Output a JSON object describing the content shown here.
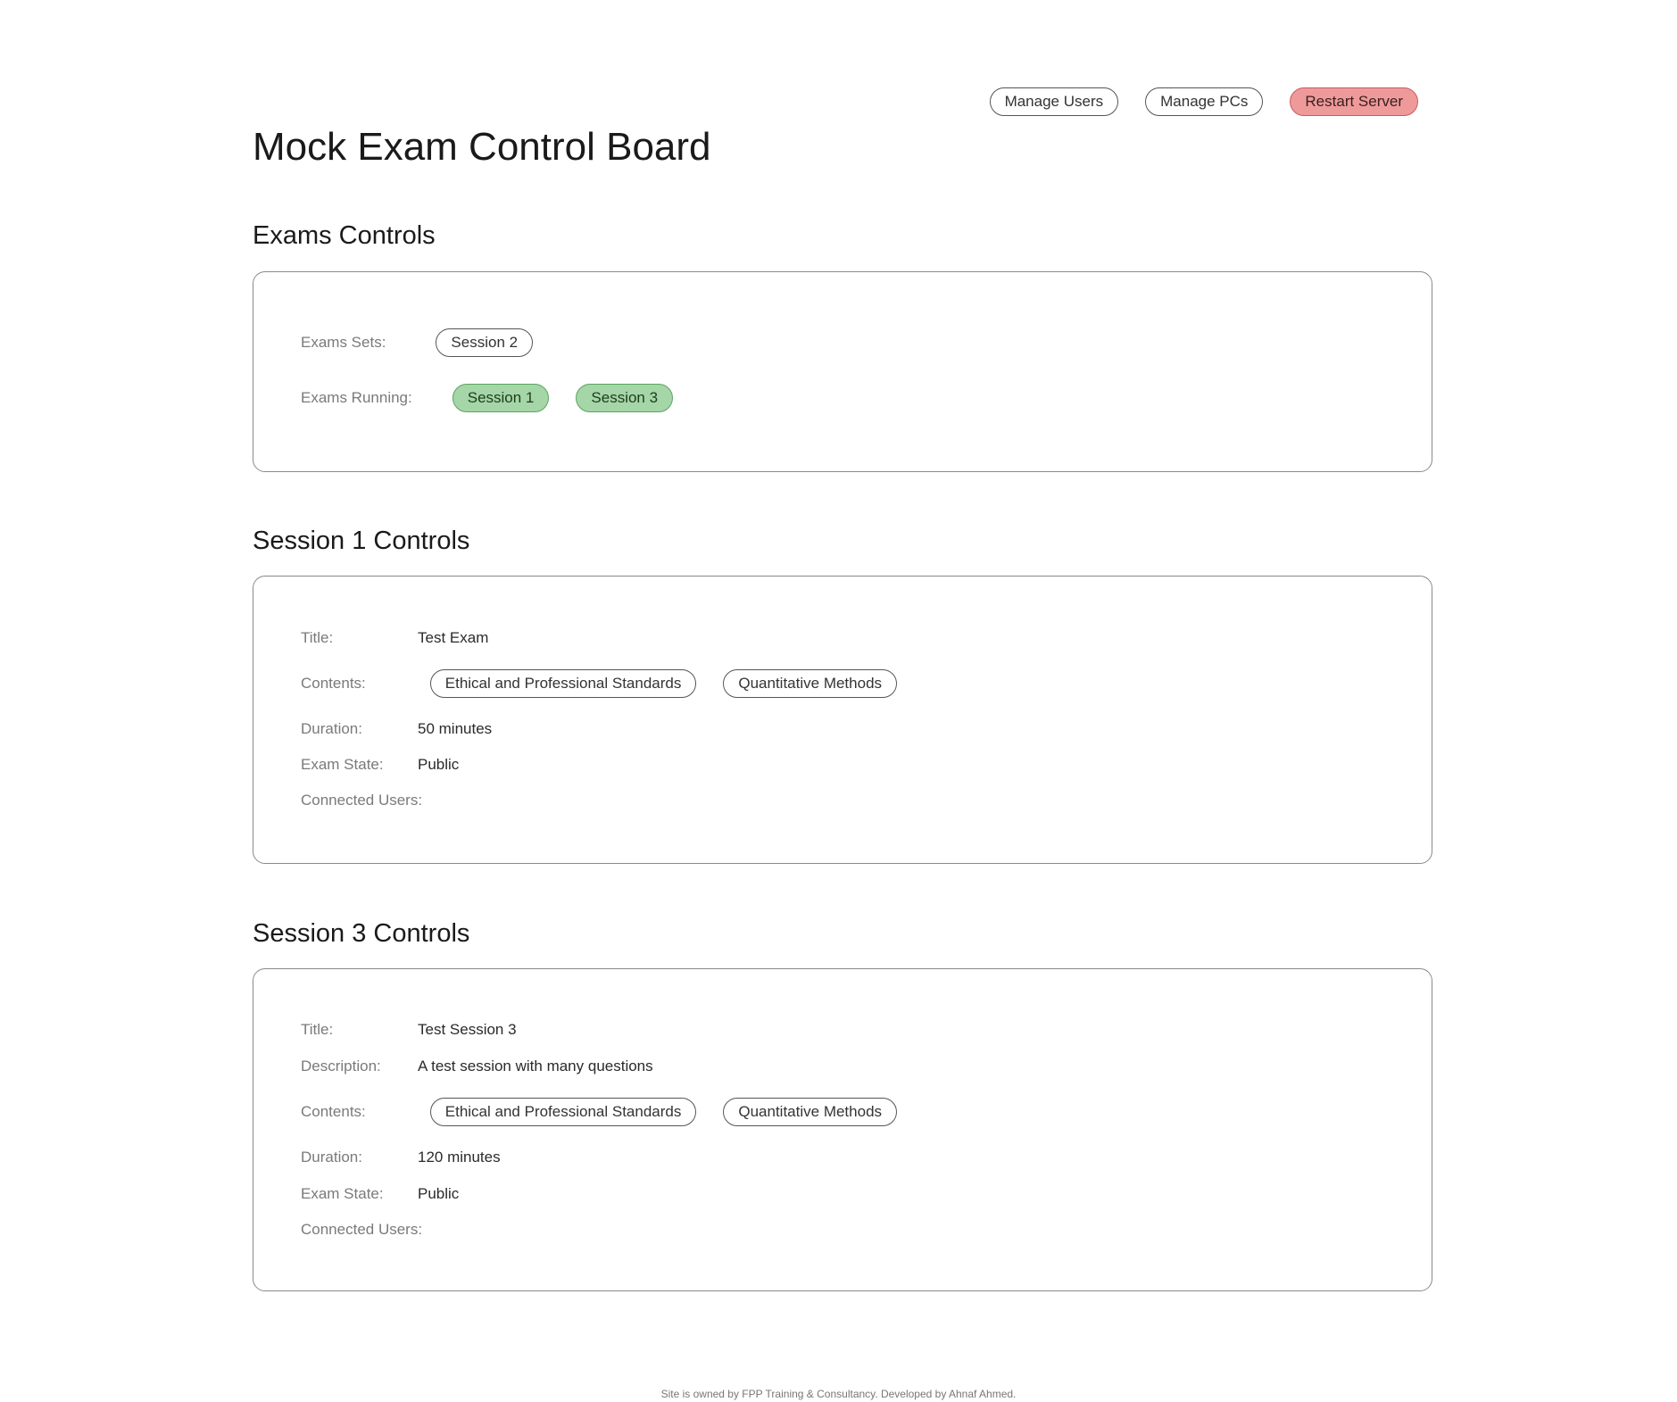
{
  "header": {
    "title": "Mock Exam Control Board",
    "actions": {
      "manage_users": "Manage Users",
      "manage_pcs": "Manage PCs",
      "restart_server": "Restart Server"
    }
  },
  "exams_controls": {
    "heading": "Exams Controls",
    "sets_label": "Exams Sets:",
    "sets": [
      "Session 2"
    ],
    "running_label": "Exams Running:",
    "running": [
      "Session 1",
      "Session 3"
    ]
  },
  "session1": {
    "heading": "Session 1 Controls",
    "title_label": "Title:",
    "title": "Test Exam",
    "contents_label": "Contents:",
    "contents": [
      "Ethical and Professional Standards",
      "Quantitative Methods"
    ],
    "duration_label": "Duration:",
    "duration": "50 minutes",
    "state_label": "Exam State:",
    "state": "Public",
    "users_label": "Connected Users:"
  },
  "session3": {
    "heading": "Session 3 Controls",
    "title_label": "Title:",
    "title": "Test Session 3",
    "description_label": "Description:",
    "description": "A test session with many questions",
    "contents_label": "Contents:",
    "contents": [
      "Ethical and Professional Standards",
      "Quantitative Methods"
    ],
    "duration_label": "Duration:",
    "duration": "120 minutes",
    "state_label": "Exam State:",
    "state": "Public",
    "users_label": "Connected Users:"
  },
  "footer": {
    "text": "Site is owned by FPP Training & Consultancy. Developed by Ahnaf Ahmed."
  },
  "colors": {
    "danger": "#ef9a9a",
    "running": "#a5d6a7",
    "border": "#8a8a8a"
  }
}
